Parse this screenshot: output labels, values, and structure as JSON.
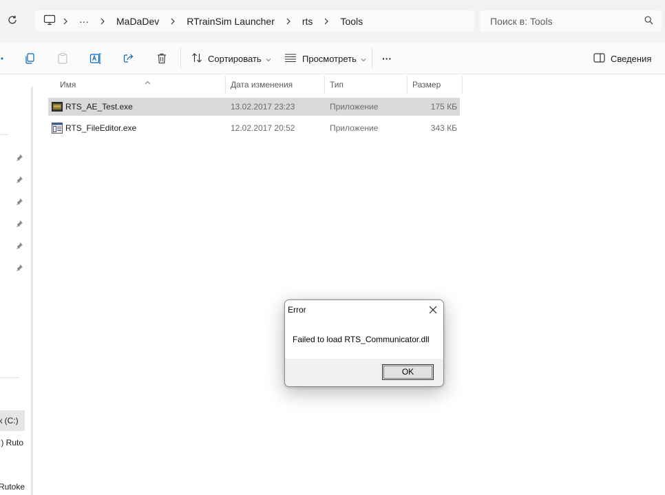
{
  "address": {
    "crumbs": [
      "MaDaDev",
      "RTrainSim Launcher",
      "rts",
      "Tools"
    ],
    "more": "···"
  },
  "search": {
    "placeholder": "Поиск в: Tools"
  },
  "toolbar": {
    "sort_label": "Сортировать",
    "view_label": "Просмотреть",
    "more": "···",
    "details_label": "Сведения"
  },
  "columns": {
    "name": "Имя",
    "date": "Дата изменения",
    "type": "Тип",
    "size": "Размер"
  },
  "files": [
    {
      "name": "RTS_AE_Test.exe",
      "date": "13.02.2017 23:23",
      "type": "Приложение",
      "size": "175 КБ"
    },
    {
      "name": "RTS_FileEditor.exe",
      "date": "12.02.2017 20:52",
      "type": "Приложение",
      "size": "343 КБ"
    }
  ],
  "nav": {
    "drives": [
      "к (C:)",
      ":) Ruto",
      "Rutoke"
    ]
  },
  "dialog": {
    "title": "Error",
    "message": "Failed to load RTS_Communicator.dll",
    "ok_label": "OK"
  },
  "colors": {
    "selection": "#d9d9d9",
    "chrome": "#f3f3f3",
    "accent": "#0067c0"
  }
}
